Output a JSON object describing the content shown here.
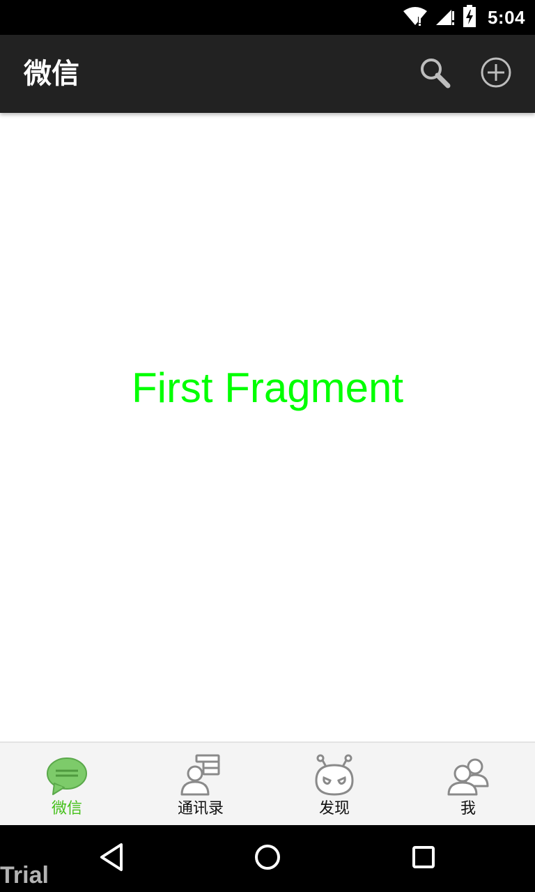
{
  "status_bar": {
    "time": "5:04",
    "icons": [
      "wifi-icon",
      "cell-signal-icon",
      "battery-charging-icon"
    ]
  },
  "action_bar": {
    "title": "微信",
    "actions": [
      {
        "name": "search",
        "icon": "search-icon"
      },
      {
        "name": "add",
        "icon": "plus-circle-icon"
      }
    ]
  },
  "content": {
    "text": "First Fragment",
    "text_color": "#00ff00"
  },
  "tabs": [
    {
      "label": "微信",
      "icon": "chat-bubble-icon",
      "active": true
    },
    {
      "label": "通讯录",
      "icon": "contacts-icon",
      "active": false
    },
    {
      "label": "发现",
      "icon": "discover-icon",
      "active": false
    },
    {
      "label": "我",
      "icon": "me-icon",
      "active": false
    }
  ],
  "colors": {
    "action_bar_bg": "#222222",
    "active_tab": "#45c01a",
    "tab_bar_bg": "#f4f4f4"
  },
  "nav_bar": {
    "buttons": [
      "back-icon",
      "home-icon",
      "recents-icon"
    ]
  },
  "watermark": "Trial"
}
